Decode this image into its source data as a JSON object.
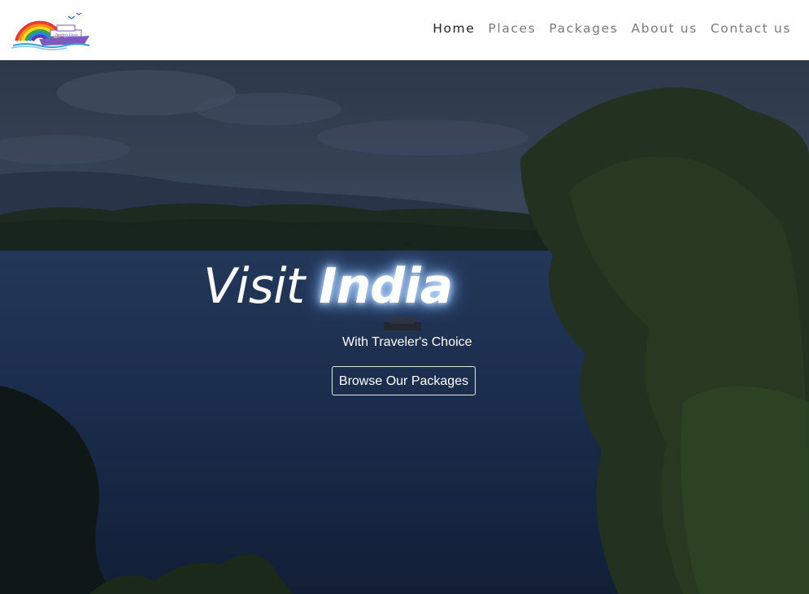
{
  "nav": {
    "links": [
      {
        "label": "Home",
        "active": true
      },
      {
        "label": "Places",
        "active": false
      },
      {
        "label": "Packages",
        "active": false
      },
      {
        "label": "About us",
        "active": false
      },
      {
        "label": "Contact us",
        "active": false
      }
    ],
    "logo_text": "Traveler's Choice"
  },
  "hero": {
    "headline_part1": "Visit ",
    "headline_part2": "India",
    "tagline": "With Traveler's Choice",
    "cta_label": "Browse Our Packages"
  },
  "colors": {
    "nav_active": "#222222",
    "nav_inactive": "#7a7a7a",
    "hero_overlay": "#1c2a44"
  }
}
